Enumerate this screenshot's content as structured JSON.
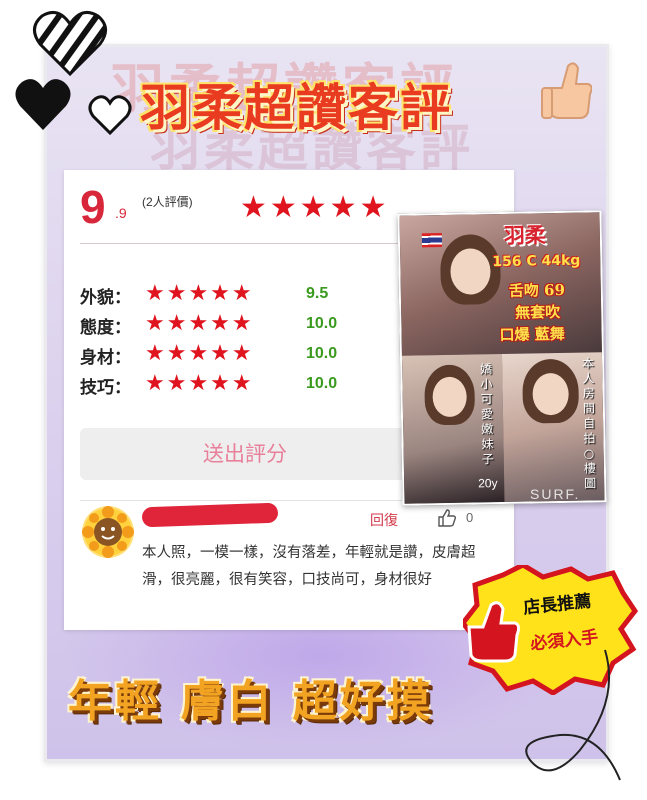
{
  "header": {
    "title": "羽柔超讚客評",
    "ghost_title": "羽柔超讚客評"
  },
  "rating": {
    "score_main": "9",
    "score_decimal": ".9",
    "reviews_count": "(2人評價)",
    "stars": "★★★★★"
  },
  "categories": [
    {
      "label": "外貌：",
      "stars": "★★★★★",
      "score": "9.5"
    },
    {
      "label": "態度：",
      "stars": "★★★★★",
      "score": "10.0"
    },
    {
      "label": "身材：",
      "stars": "★★★★★",
      "score": "10.0"
    },
    {
      "label": "技巧：",
      "stars": "★★★★★",
      "score": "10.0"
    }
  ],
  "submit_button": "送出評分",
  "comment": {
    "reply_label": "回復",
    "like_count": "0",
    "text": "本人照，一模一樣，沒有落差，年輕就是讚，皮膚超滑，很亮麗，很有笑容，口技尚可，身材很好"
  },
  "photo": {
    "name": "羽柔",
    "stats": "156 C 44kg",
    "line1": "舌吻 69",
    "line2": "無套吹",
    "line3": "口爆 藍舞",
    "left_vertical": "嬌小可愛嫩妹子",
    "age": "20y",
    "right_vertical": "本人房間自拍○樓圖",
    "watermark": "SURF."
  },
  "bottom_text": "年輕 膚白 超好摸",
  "badge": {
    "line1": "店長推薦",
    "line2": "必須入手"
  },
  "colors": {
    "accent_red": "#e0141e",
    "score_green": "#3a9a1e",
    "title_red": "#e83b1f",
    "bottom_orange": "#f2a322"
  },
  "icons": [
    "thumbs-up-icon",
    "striped-heart-icon",
    "black-heart-icon",
    "outline-heart-icon",
    "like-icon",
    "flag-icon"
  ]
}
